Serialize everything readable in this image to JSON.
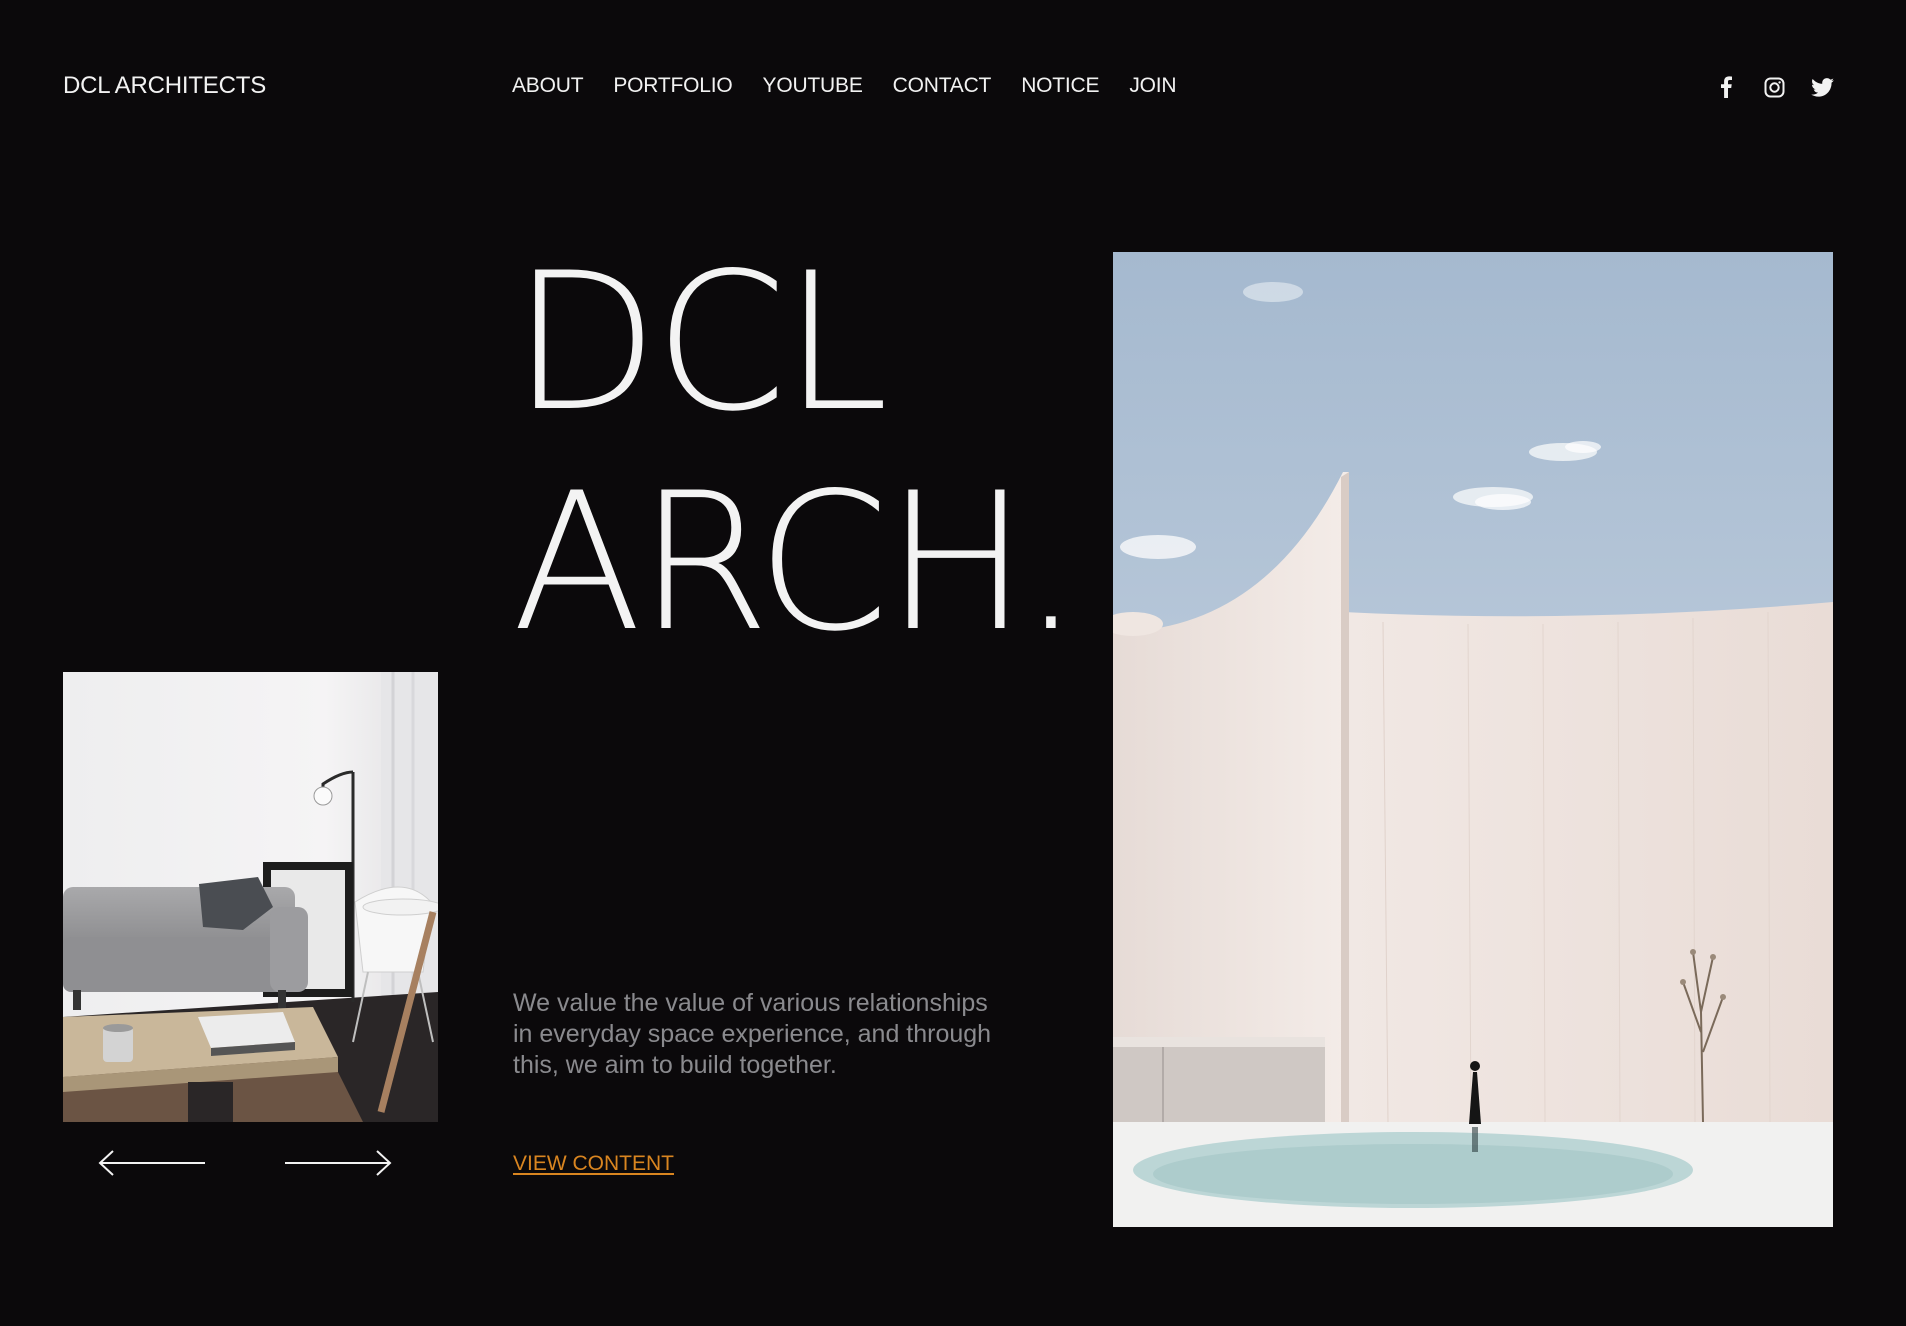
{
  "header": {
    "brand": "DCL ARCHITECTS",
    "nav": [
      "ABOUT",
      "PORTFOLIO",
      "YOUTUBE",
      "CONTACT",
      "NOTICE",
      "JOIN"
    ],
    "social_icons": [
      "facebook-icon",
      "instagram-icon",
      "twitter-icon"
    ]
  },
  "hero": {
    "title_line1": "DCL",
    "title_line2": "ARCH.",
    "description": "We value the value of various relationships in everyday space experience, and through this, we aim to build together.",
    "cta_label": "VIEW CONTENT"
  },
  "slider": {
    "prev_icon": "arrow-left-icon",
    "next_icon": "arrow-right-icon"
  },
  "colors": {
    "background": "#0b090b",
    "text": "#f2f2f2",
    "muted": "#8a8a8e",
    "accent": "#d98520"
  }
}
